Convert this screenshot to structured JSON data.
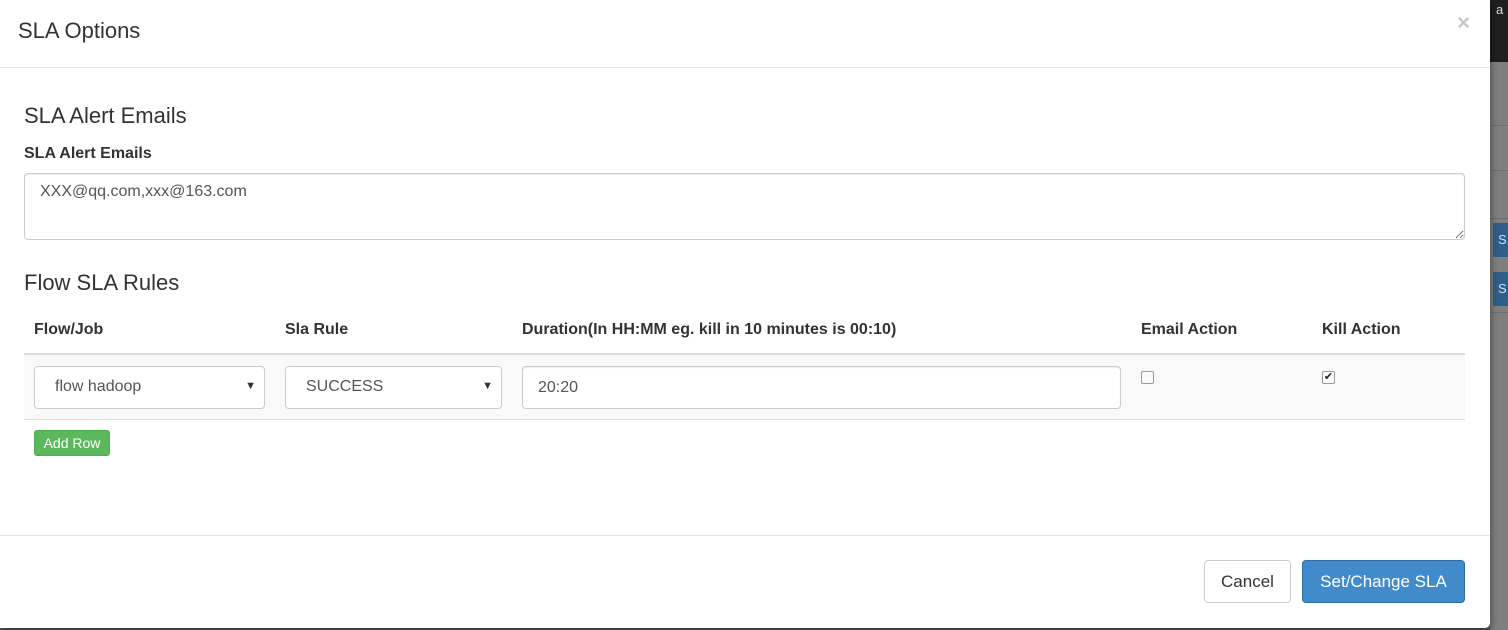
{
  "background": {
    "top_text": "a",
    "btn1_text": "S",
    "btn2_text": "S"
  },
  "modal": {
    "title": "SLA Options",
    "close_symbol": "×"
  },
  "emails": {
    "heading": "SLA Alert Emails",
    "label": "SLA Alert Emails",
    "value": "XXX@qq.com,xxx@163.com"
  },
  "rules": {
    "heading": "Flow SLA Rules",
    "columns": {
      "flow_job": "Flow/Job",
      "sla_rule": "Sla Rule",
      "duration": "Duration(In HH:MM eg. kill in 10 minutes is 00:10)",
      "email_action": "Email Action",
      "kill_action": "Kill Action"
    },
    "rows": [
      {
        "flow_job": "flow hadoop",
        "sla_rule": "SUCCESS",
        "duration": "20:20",
        "email_action": false,
        "kill_action": true
      }
    ],
    "add_row_label": "Add Row"
  },
  "footer": {
    "cancel_label": "Cancel",
    "submit_label": "Set/Change SLA"
  },
  "colors": {
    "primary": "#428bca",
    "success": "#5cb85c"
  }
}
